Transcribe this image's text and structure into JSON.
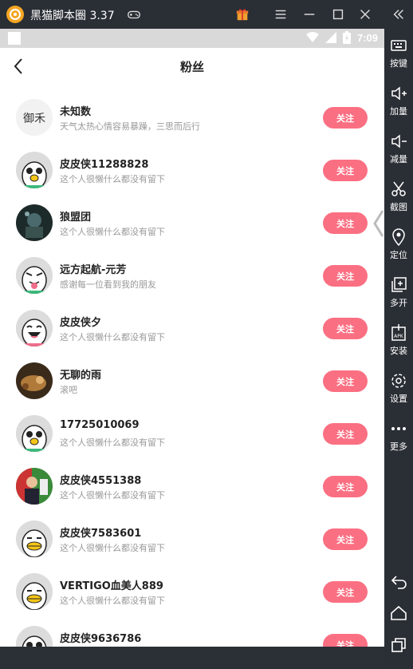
{
  "window": {
    "title": "黑猫脚本圈 3.37"
  },
  "status_bar": {
    "time": "7:09"
  },
  "app": {
    "page_title": "粉丝",
    "follow_label": "关注",
    "followers": [
      {
        "name": "未知数",
        "signature": "天气太热心情容易暴躁，三思而后行",
        "avatar": "calligraphy-avatar"
      },
      {
        "name": "皮皮侠11288828",
        "signature": "这个人很懒什么都没有留下",
        "avatar": "default-penguin-avatar"
      },
      {
        "name": "狼盟团",
        "signature": "这个人很懒什么都没有留下",
        "avatar": "dark-photo-avatar"
      },
      {
        "name": "远方起航-元芳",
        "signature": "感谢每一位看到我的朋友",
        "avatar": "tongue-face-avatar"
      },
      {
        "name": "皮皮侠夕",
        "signature": "这个人很懒什么都没有留下",
        "avatar": "laughing-face-avatar"
      },
      {
        "name": "无聊的雨",
        "signature": "滚吧",
        "avatar": "animal-photo-avatar"
      },
      {
        "name": "17725010069",
        "signature": "这个人很懒什么都没有留下",
        "avatar": "default-penguin-avatar"
      },
      {
        "name": "皮皮侠4551388",
        "signature": "这个人很懒什么都没有留下",
        "avatar": "person-photo-avatar"
      },
      {
        "name": "皮皮侠7583601",
        "signature": "这个人很懒什么都没有留下",
        "avatar": "duck-face-avatar"
      },
      {
        "name": "VERTIGO血美人889",
        "signature": "这个人很懒什么都没有留下",
        "avatar": "duck-face-avatar"
      },
      {
        "name": "皮皮侠9636786",
        "signature": "",
        "avatar": "default-penguin-avatar"
      }
    ]
  },
  "toolbar": {
    "items": [
      {
        "label": "按键",
        "icon": "keyboard-icon"
      },
      {
        "label": "加量",
        "icon": "volume-up-icon"
      },
      {
        "label": "减量",
        "icon": "volume-down-icon"
      },
      {
        "label": "截图",
        "icon": "scissors-icon"
      },
      {
        "label": "定位",
        "icon": "location-pin-icon"
      },
      {
        "label": "多开",
        "icon": "multi-instance-icon"
      },
      {
        "label": "安装",
        "icon": "apk-install-icon"
      },
      {
        "label": "设置",
        "icon": "gear-icon"
      },
      {
        "label": "更多",
        "icon": "more-dots-icon"
      }
    ]
  },
  "colors": {
    "follow_button": "#fb6f82",
    "chrome": "#2a2e35",
    "status_bar": "#d9d9d9"
  }
}
